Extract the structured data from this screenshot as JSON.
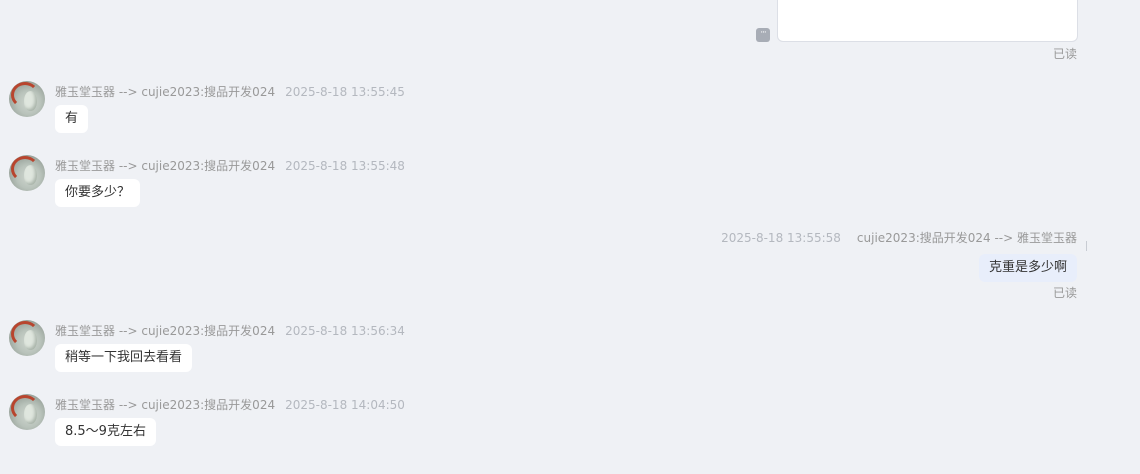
{
  "read_label": "已读",
  "more_icon_glyph": "···",
  "colors": {
    "background": "#eff1f5",
    "incoming_bubble": "#ffffff",
    "outgoing_bubble": "#e8eefb",
    "meta_text": "#999999",
    "time_text": "#b4b8bf",
    "message_text": "#333333"
  },
  "messages": [
    {
      "direction": "incoming",
      "sender_line": "雅玉堂玉器 --> cujie2023:搜品开发024",
      "time": "2025-8-18 13:55:45",
      "text": "有"
    },
    {
      "direction": "incoming",
      "sender_line": "雅玉堂玉器 --> cujie2023:搜品开发024",
      "time": "2025-8-18 13:55:48",
      "text": "你要多少？"
    },
    {
      "direction": "outgoing",
      "sender_line": "cujie2023:搜品开发024 --> 雅玉堂玉器",
      "time": "2025-8-18 13:55:58",
      "text": "克重是多少啊"
    },
    {
      "direction": "incoming",
      "sender_line": "雅玉堂玉器 --> cujie2023:搜品开发024",
      "time": "2025-8-18 13:56:34",
      "text": "稍等一下我回去看看"
    },
    {
      "direction": "incoming",
      "sender_line": "雅玉堂玉器 --> cujie2023:搜品开发024",
      "time": "2025-8-18 14:04:50",
      "text": "8.5～9克左右"
    }
  ]
}
